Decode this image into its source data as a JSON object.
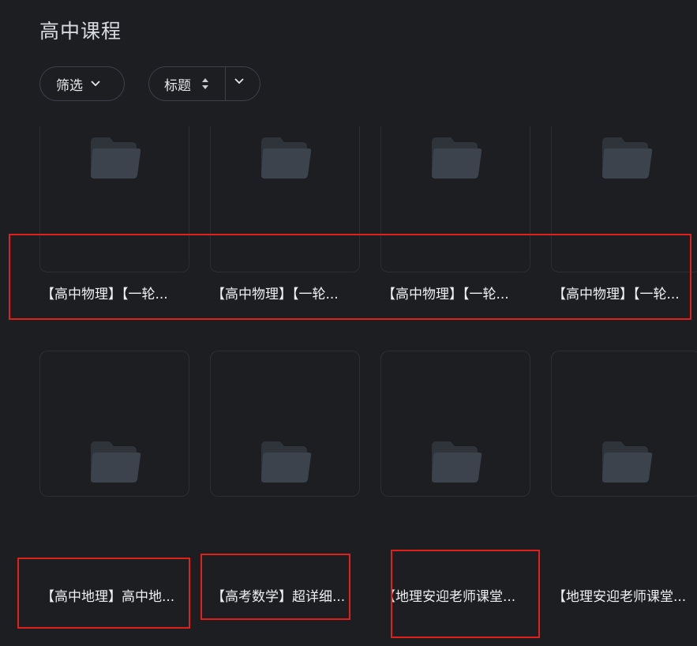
{
  "page": {
    "title": "高中课程"
  },
  "toolbar": {
    "filter_label": "筛选",
    "sort_label": "标题"
  },
  "folders": [
    {
      "caption": "【高中物理】【一轮..."
    },
    {
      "caption": "【高中物理】【一轮..."
    },
    {
      "caption": "【高中物理】【一轮..."
    },
    {
      "caption": "【高中物理】【一轮..."
    },
    {
      "caption": "【高中地理】高中地..."
    },
    {
      "caption": "【高考数学】超详细..."
    },
    {
      "caption": "【地理安迎老师课堂..."
    },
    {
      "caption": "【地理安迎老师课堂..."
    }
  ],
  "colors": {
    "highlight": "#e0201b",
    "background": "#1c1e22",
    "folder": "#3a4048"
  }
}
